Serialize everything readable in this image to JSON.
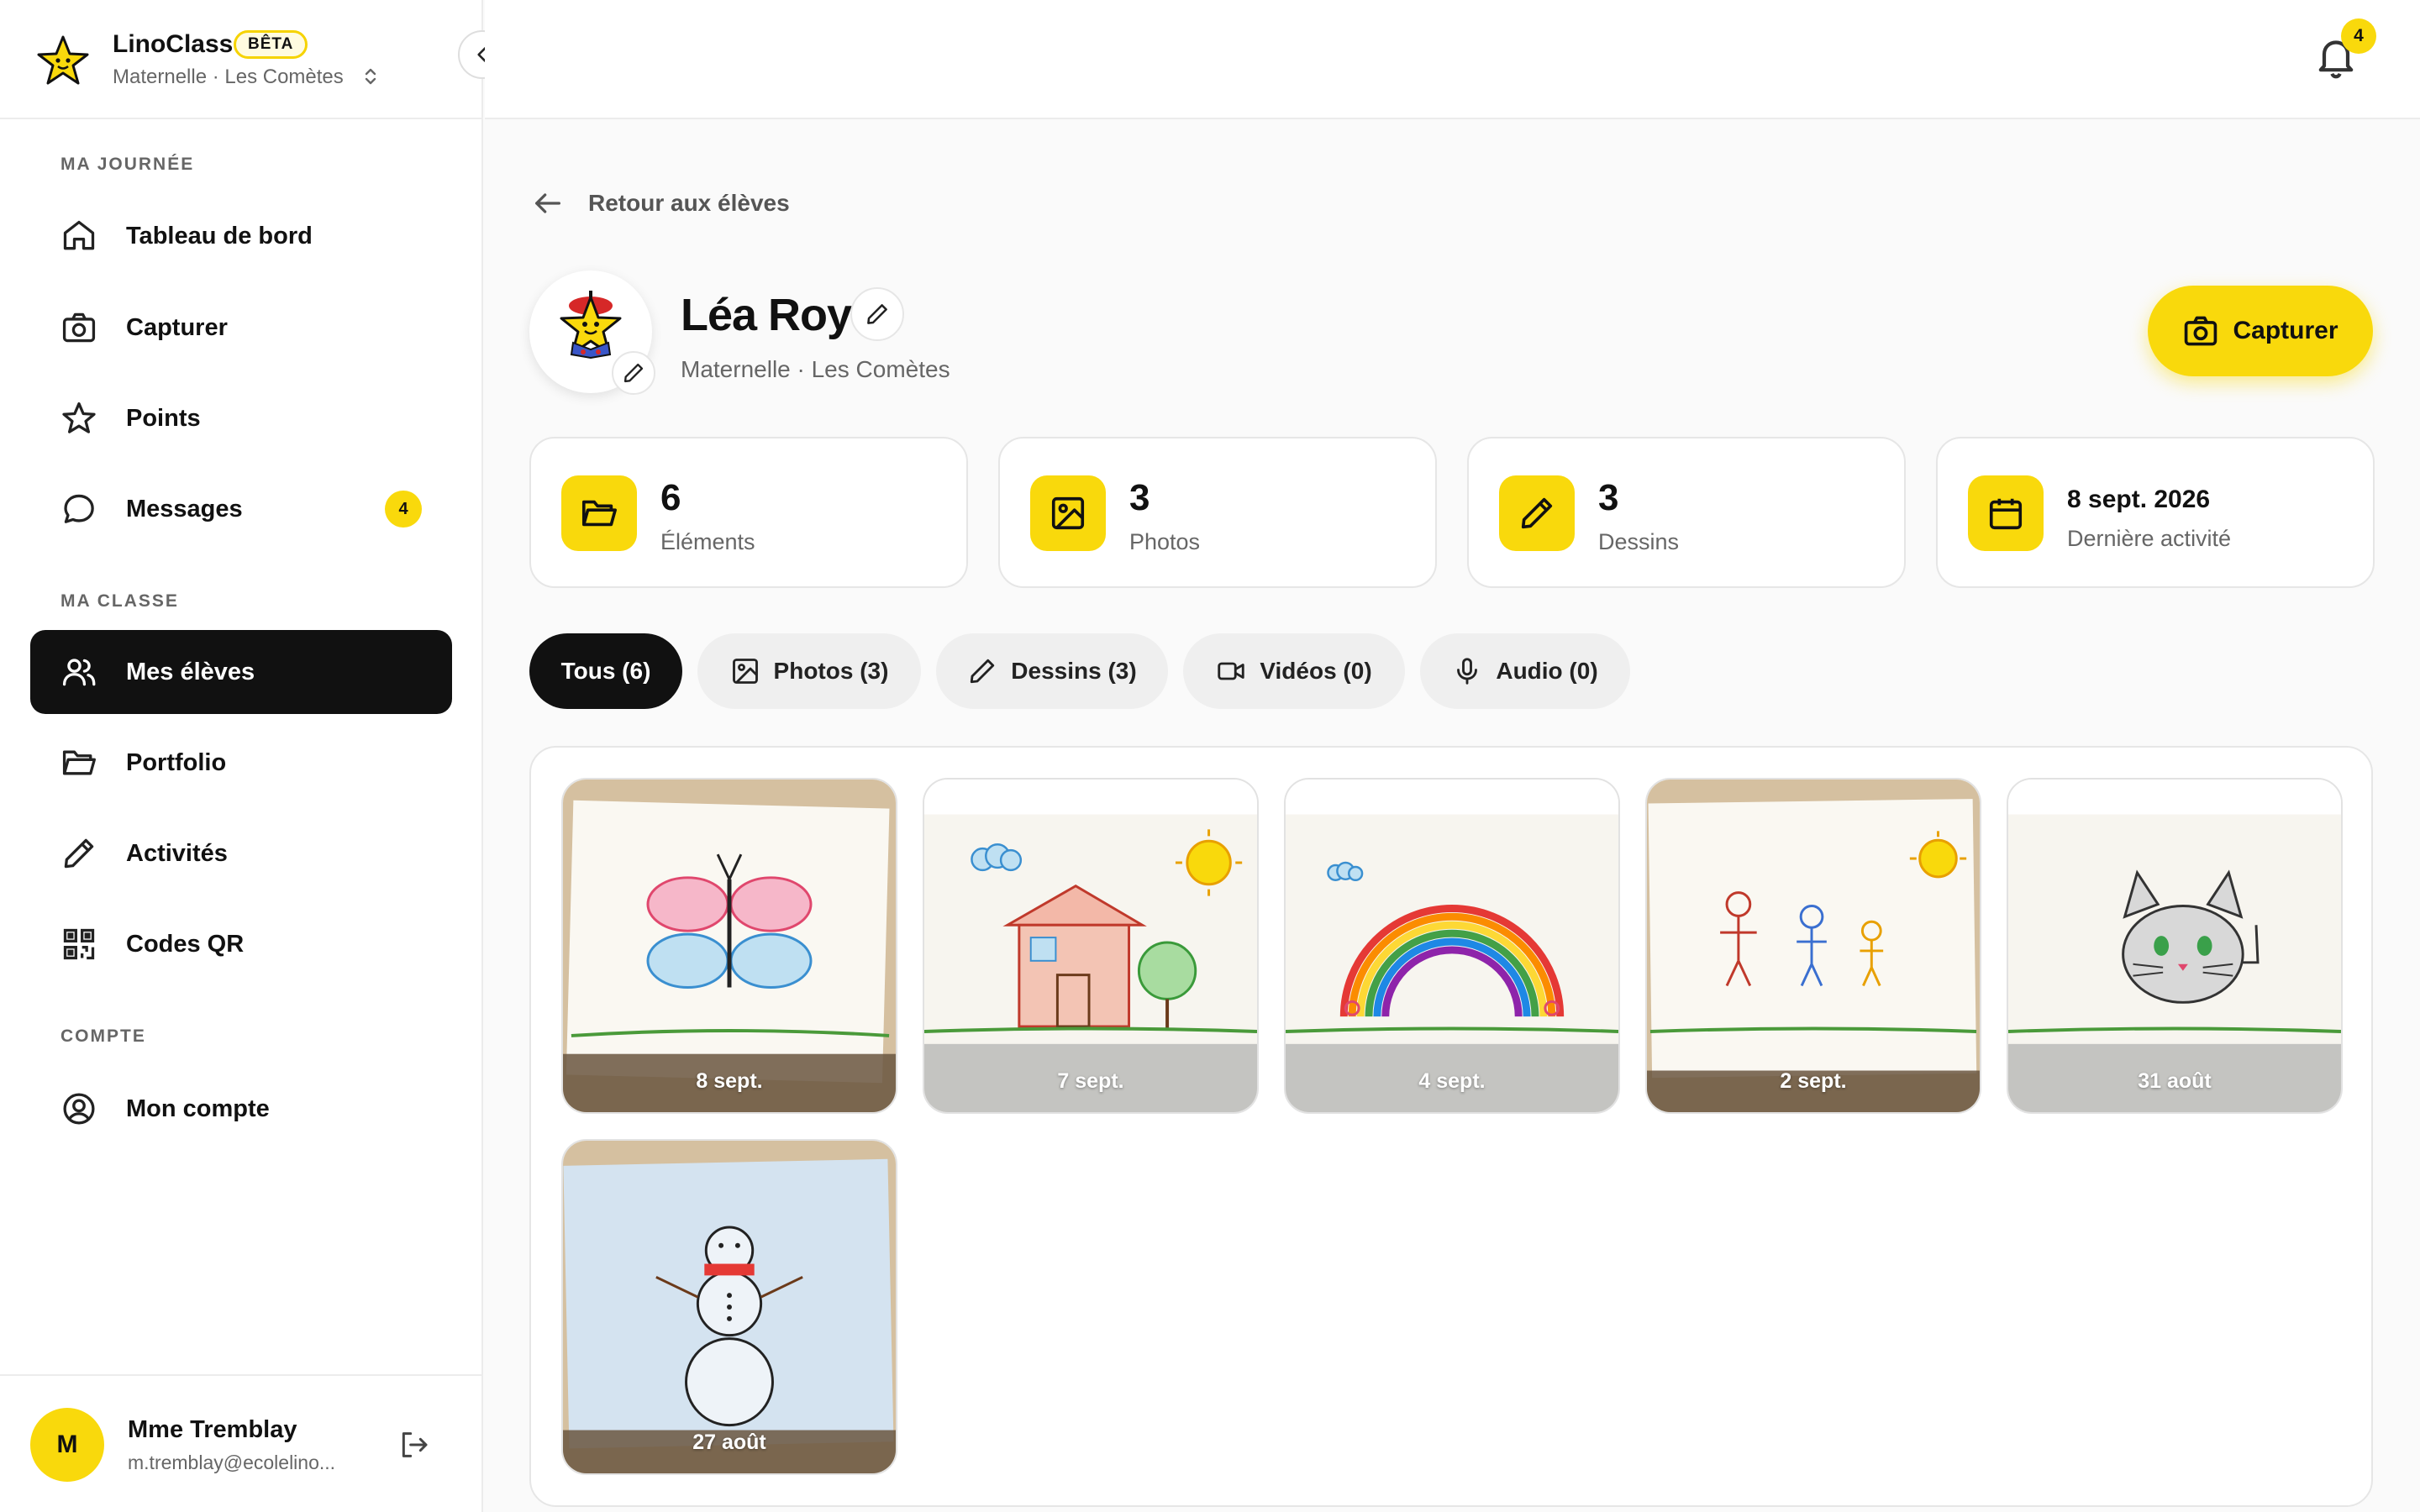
{
  "brand": {
    "name": "LinoClass",
    "badge": "BÊTA",
    "subtitle": "Maternelle · Les Comètes"
  },
  "sidebar": {
    "sections": [
      {
        "label": "MA JOURNÉE"
      },
      {
        "label": "MA CLASSE"
      },
      {
        "label": "COMPTE"
      }
    ],
    "items": [
      {
        "label": "Tableau de bord",
        "icon": "home-icon"
      },
      {
        "label": "Capturer",
        "icon": "camera-icon"
      },
      {
        "label": "Points",
        "icon": "star-icon"
      },
      {
        "label": "Messages",
        "icon": "message-icon",
        "badge": "4"
      },
      {
        "label": "Mes élèves",
        "icon": "users-icon",
        "active": true
      },
      {
        "label": "Portfolio",
        "icon": "folder-icon"
      },
      {
        "label": "Activités",
        "icon": "pencil-icon"
      },
      {
        "label": "Codes QR",
        "icon": "qr-icon"
      },
      {
        "label": "Mon compte",
        "icon": "user-circle-icon"
      }
    ]
  },
  "user": {
    "initial": "M",
    "name": "Mme Tremblay",
    "email": "m.tremblay@ecolelino..."
  },
  "topbar": {
    "notifications": "4"
  },
  "back": {
    "label": "Retour aux élèves"
  },
  "student": {
    "name": "Léa Roy",
    "class": "Maternelle · Les Comètes"
  },
  "capture_button": {
    "label": "Capturer"
  },
  "stats": [
    {
      "value": "6",
      "label": "Éléments",
      "icon": "folder-icon"
    },
    {
      "value": "3",
      "label": "Photos",
      "icon": "image-icon"
    },
    {
      "value": "3",
      "label": "Dessins",
      "icon": "pencil-icon"
    },
    {
      "value": "8 sept. 2026",
      "label": "Dernière activité",
      "icon": "calendar-icon"
    }
  ],
  "filters": [
    {
      "label": "Tous (6)",
      "active": true
    },
    {
      "label": "Photos (3)",
      "icon": "image-icon"
    },
    {
      "label": "Dessins (3)",
      "icon": "pencil-icon"
    },
    {
      "label": "Vidéos (0)",
      "icon": "video-icon"
    },
    {
      "label": "Audio (0)",
      "icon": "mic-icon"
    }
  ],
  "gallery": [
    {
      "date": "8 sept.",
      "subject": "butterfly"
    },
    {
      "date": "7 sept.",
      "subject": "house"
    },
    {
      "date": "4 sept.",
      "subject": "rainbow"
    },
    {
      "date": "2 sept.",
      "subject": "family"
    },
    {
      "date": "31 août",
      "subject": "cat"
    },
    {
      "date": "27 août",
      "subject": "snowman"
    }
  ],
  "colors": {
    "accent": "#f9d90c",
    "active_nav": "#111111"
  }
}
